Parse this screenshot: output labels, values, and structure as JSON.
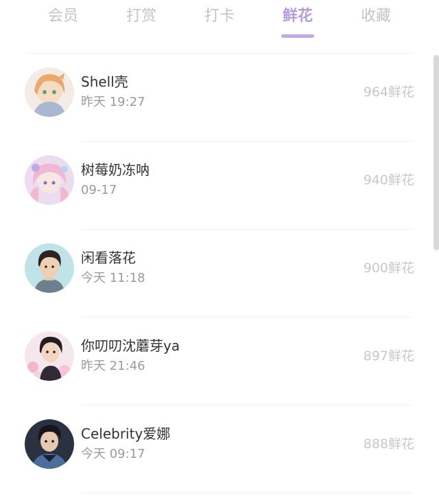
{
  "tabs": [
    {
      "label": "会员",
      "active": false
    },
    {
      "label": "打赏",
      "active": false
    },
    {
      "label": "打卡",
      "active": false
    },
    {
      "label": "鲜花",
      "active": true
    },
    {
      "label": "收藏",
      "active": false
    }
  ],
  "list": [
    {
      "name": "Shell壳",
      "time": "昨天 19:27",
      "flowers": "964鲜花"
    },
    {
      "name": "树莓奶冻呐",
      "time": "09-17",
      "flowers": "940鲜花"
    },
    {
      "name": "闲看落花",
      "time": "今天 11:18",
      "flowers": "900鲜花"
    },
    {
      "name": "你叨叨沈蘑芽ya",
      "time": "昨天 21:46",
      "flowers": "897鲜花"
    },
    {
      "name": "Celebrity爱娜",
      "time": "今天 09:17",
      "flowers": "888鲜花"
    }
  ],
  "colors": {
    "accent": "#b69bdd",
    "inactive_tab": "#c4c4c4",
    "name_text": "#333333",
    "time_text": "#9a9a9a",
    "flowers_text": "#c8c8c8"
  }
}
